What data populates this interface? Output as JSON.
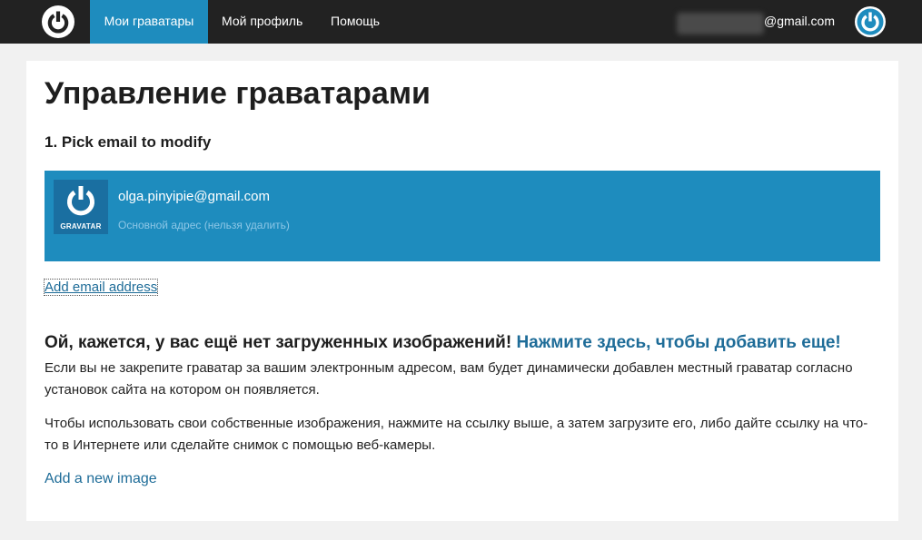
{
  "header": {
    "nav": [
      {
        "label": "Мои граватары",
        "active": true
      },
      {
        "label": "Мой профиль",
        "active": false
      },
      {
        "label": "Помощь",
        "active": false
      }
    ],
    "account_email_domain": "@gmail.com"
  },
  "main": {
    "title": "Управление граватарами",
    "step_title": "1. Pick email to modify",
    "email_row": {
      "avatar_label": "GRAVATAR",
      "email": "olga.pinyipie@gmail.com",
      "note": "Основной адрес (нельзя удалить)"
    },
    "add_email_link": "Add email address",
    "no_images_heading": "Ой, кажется, у вас ещё нет загруженных изображений!",
    "no_images_cta": "Нажмите здесь, чтобы добавить еще!",
    "paragraph_1": "Если вы не закрепите граватар за вашим электронным адресом, вам будет динамически добавлен местный граватар согласно установок сайта на котором он появляется.",
    "paragraph_2": "Чтобы использовать свои собственные изображения, нажмите на ссылку выше, а затем загрузите его, либо дайте ссылку на что-то в Интернете или сделайте снимок с помощью веб-камеры.",
    "add_image_link": "Add a new image"
  },
  "colors": {
    "topbar": "#222222",
    "accent": "#1e8cbe",
    "link": "#1e6c98",
    "background": "#f1f1f1"
  },
  "icons": {
    "logo": "gravatar-logo-icon",
    "account": "account-avatar-icon",
    "row_avatar": "gravatar-avatar-icon"
  }
}
